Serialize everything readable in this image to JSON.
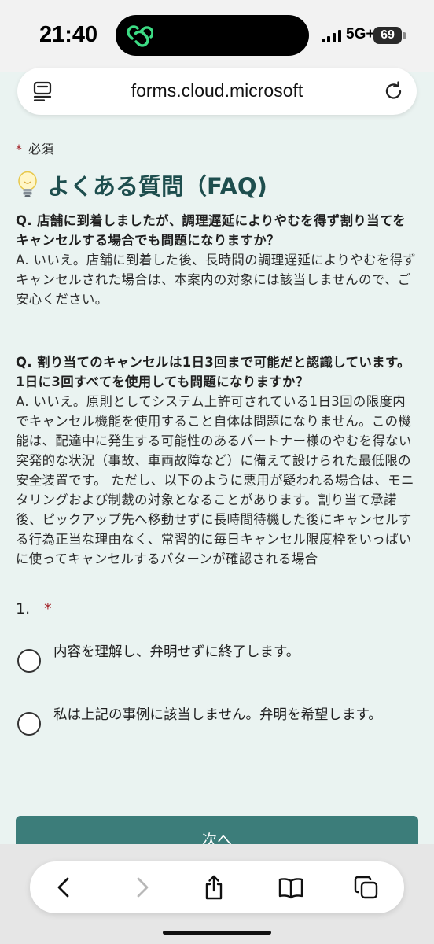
{
  "status_bar": {
    "time": "21:40",
    "network": "5G+",
    "battery": "69",
    "island_app_icon": "link-chain-icon"
  },
  "url_bar": {
    "url": "forms.cloud.microsoft",
    "left_icon": "reader-icon",
    "right_icon": "reload-icon"
  },
  "form": {
    "required_star": "*",
    "required_label": "必須",
    "faq_icon": "lightbulb-icon",
    "faq_title": "よくある質問（FAQ)",
    "qa": [
      {
        "question": "Q. 店舗に到着しましたが、調理遅延によりやむを得ず割り当てをキャンセルする場合でも問題になりますか？",
        "answer": "A. いいえ。店舗に到着した後、長時間の調理遅延によりやむを得ずキャンセルされた場合は、本案内の対象には該当しませんので、ご安心ください。"
      },
      {
        "question": "Q. 割り当てのキャンセルは1日3回まで可能だと認識しています。1日に3回すべてを使用しても問題になりますか？",
        "answer": "A. いいえ。原則としてシステム上許可されている1日3回の限度内でキャンセル機能を使用すること自体は問題になりません。この機能は、配達中に発生する可能性のあるパートナー様のやむを得ない突発的な状況（事故、車両故障など）に備えて設けられた最低限の安全装置です。 ただし、以下のように悪用が疑われる場合は、モニタリングおよび制裁の対象となることがあります。割り当て承諾後、ピックアップ先へ移動せずに長時間待機した後にキャンセルする行為正当な理由なく、常習的に毎日キャンセル限度枠をいっぱいに使ってキャンセルするパターンが確認される場合"
      }
    ],
    "question_number": "1.",
    "question_required_star": "*",
    "options": [
      {
        "label": "内容を理解し、弁明せずに終了します。",
        "selected": false
      },
      {
        "label": "私は上記の事例に該当しません。弁明を希望します。",
        "selected": false
      }
    ],
    "next_button": "次へ",
    "accent_color": "#3c7d7a",
    "title_color": "#1e4e4e",
    "required_color": "#a4262c",
    "background_color": "#eaf3f1"
  },
  "toolbar": {
    "icons": [
      "back-icon",
      "forward-icon",
      "share-icon",
      "bookmarks-icon",
      "tabs-icon"
    ]
  }
}
